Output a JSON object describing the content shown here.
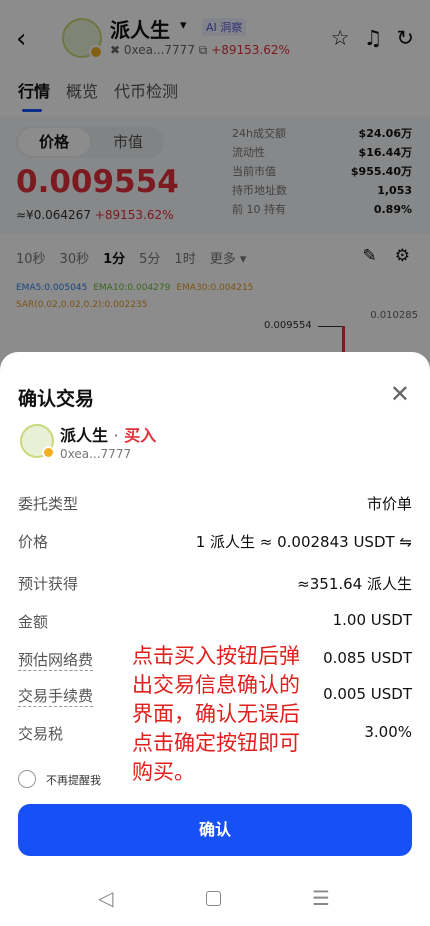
{
  "header": {
    "token_name": "派人生",
    "caret": "▾",
    "ai_badge": "AI 洞察",
    "address": "✖ 0xea...7777 ⧉",
    "change": "+89153.62%"
  },
  "tabs": [
    "行情",
    "概览",
    "代币检测"
  ],
  "price_panel": {
    "toggle_price": "价格",
    "toggle_mcap": "市值",
    "price": "0.009554",
    "cny": "≈¥0.064267",
    "change": "+89153.62%",
    "stats": [
      {
        "k": "24h成交额",
        "v": "$24.06万"
      },
      {
        "k": "流动性",
        "v": "$16.44万"
      },
      {
        "k": "当前市值",
        "v": "$955.40万"
      },
      {
        "k": "持币地址数",
        "v": "1,053"
      },
      {
        "k": "前 10 持有",
        "v": "0.89%"
      }
    ]
  },
  "intervals": [
    "10秒",
    "30秒",
    "1分",
    "5分",
    "1时",
    "更多 ▾"
  ],
  "indicators": {
    "ema5": "EMA5:0.005045",
    "ema10": "EMA10:0.004279",
    "ema30": "EMA30:0.004215",
    "sar": "SAR(0.02,0.02,0.2):0.002235",
    "current_label": "0.009554",
    "right_label": "0.010285"
  },
  "sheet": {
    "title": "确认交易",
    "token_name": "派人生",
    "separator": "·",
    "side": "买入",
    "address": "0xea...7777",
    "fields": [
      {
        "label": "委托类型",
        "value": "市价单",
        "underline": false
      },
      {
        "label": "价格",
        "value": "1 派人生 ≈ 0.002843 USDT  ⇋",
        "underline": false
      },
      {
        "label": "预计获得",
        "value": "≈351.64 派人生",
        "underline": false
      },
      {
        "label": "金额",
        "value": "1.00 USDT",
        "underline": false
      },
      {
        "label": "预估网络费",
        "value": "0.085 USDT",
        "underline": true
      },
      {
        "label": "交易手续费",
        "value": "0.005 USDT",
        "underline": true
      },
      {
        "label": "交易税",
        "value": "3.00%",
        "underline": false
      }
    ],
    "annotation": "点击买入按钮后弹出交易信息确认的界面，确认无误后点击确定按钮即可购买。",
    "dont_remind": "不再提醒我",
    "confirm": "确认"
  },
  "colors": {
    "accent": "#1750f5",
    "up_red": "#e0303c",
    "annotation_red": "#e0201c"
  },
  "icons": [
    "back-arrow-icon",
    "star-icon",
    "bell-icon",
    "refresh-icon",
    "edit-icon",
    "settings-icon",
    "close-icon",
    "nav-back-icon",
    "nav-home-icon",
    "nav-menu-icon"
  ]
}
